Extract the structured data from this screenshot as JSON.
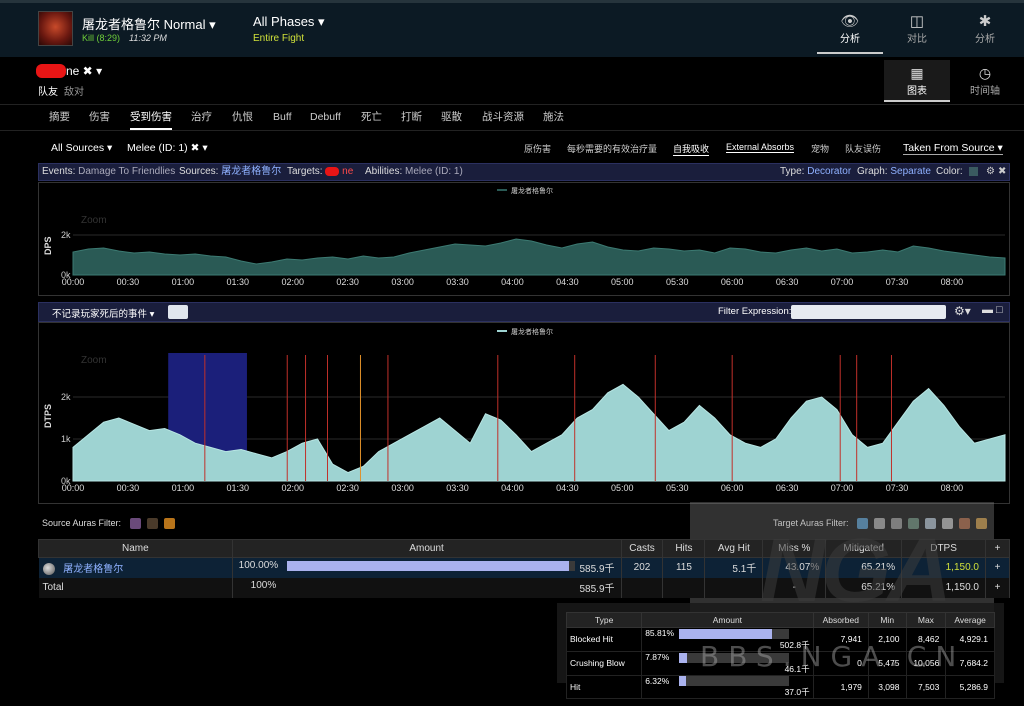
{
  "header": {
    "encounter_title": "屠龙者格鲁尔 Normal ▾",
    "kill_text": "Kill (8:29)",
    "time_text": "11:32 PM",
    "phase_title": "All Phases ▾",
    "phase_sub": "Entire Fight",
    "nav": [
      {
        "label": "分析",
        "icon": "eye-icon"
      },
      {
        "label": "对比",
        "icon": "compare-icon"
      },
      {
        "label": "分析",
        "icon": "puzzle-icon"
      }
    ]
  },
  "player": {
    "name_suffix": "ne ✖ ▾",
    "ally": "队友",
    "enemy": "敌对",
    "views": [
      {
        "label": "图表",
        "icon": "grid-icon"
      },
      {
        "label": "时间轴",
        "icon": "clock-icon"
      }
    ]
  },
  "tabs": [
    "摘要",
    "伤害",
    "受到伤害",
    "治疗",
    "仇恨",
    "Buff",
    "Debuff",
    "死亡",
    "打断",
    "驱散",
    "战斗资源",
    "施法"
  ],
  "filters": {
    "sources": "All Sources ▾",
    "ability": "Melee (ID: 1) ✖ ▾",
    "right_options": [
      "原伤害",
      "每秒需要的有效治疗量",
      "自我吸收",
      "External Absorbs",
      "宠物",
      "队友误伤"
    ],
    "taken": "Taken From Source ▾"
  },
  "events_bar": {
    "events_k": "Events:",
    "events_v": "Damage To Friendlies",
    "sources_k": "Sources:",
    "sources_v": "屠龙者格鲁尔",
    "targets_k": "Targets:",
    "targets_v": "ne",
    "abilities_k": "Abilities:",
    "abilities_v": "Melee (ID: 1)",
    "type_k": "Type:",
    "type_v": "Decorator",
    "graph_k": "Graph:",
    "graph_v": "Separate",
    "color_k": "Color:"
  },
  "chart_data": [
    {
      "type": "area",
      "legend": "屠龙者格鲁尔",
      "ylabel": "DPS",
      "zoom_label": "Zoom",
      "yticks": [
        "2k",
        "0k"
      ],
      "ylim": [
        0,
        3000
      ],
      "xticks": [
        "00:00",
        "00:30",
        "01:00",
        "01:30",
        "02:00",
        "02:30",
        "03:00",
        "03:30",
        "04:00",
        "04:30",
        "05:00",
        "05:30",
        "06:00",
        "06:30",
        "07:00",
        "07:30",
        "08:00"
      ],
      "x_seconds_range": [
        0,
        509
      ],
      "values": [
        1150,
        1300,
        1350,
        1200,
        1100,
        1150,
        1050,
        1000,
        1050,
        950,
        900,
        700,
        550,
        650,
        800,
        750,
        850,
        900,
        800,
        950,
        850,
        900,
        1100,
        1250,
        1400,
        1550,
        1500,
        1450,
        1600,
        1800,
        1700,
        1500,
        1350,
        1550,
        1650,
        1400,
        1250,
        1200,
        1350,
        1300,
        1200,
        1250,
        1100,
        1350,
        1300,
        1150,
        1100,
        1250,
        1350,
        1200,
        1300,
        1100,
        1150,
        1250,
        1150,
        1450,
        1350,
        1200,
        1100,
        1000,
        900,
        850
      ]
    },
    {
      "type": "area",
      "legend": "屠龙者格鲁尔",
      "ylabel": "DTPS",
      "zoom_label": "Zoom",
      "yticks": [
        "2k",
        "1k",
        "0k"
      ],
      "ylim": [
        0,
        3000
      ],
      "xticks": [
        "00:00",
        "00:30",
        "01:00",
        "01:30",
        "02:00",
        "02:30",
        "03:00",
        "03:30",
        "04:00",
        "04:30",
        "05:00",
        "05:30",
        "06:00",
        "06:30",
        "07:00",
        "07:30",
        "08:00"
      ],
      "x_seconds_range": [
        0,
        509
      ],
      "values": [
        800,
        1100,
        1400,
        1500,
        1350,
        1200,
        1250,
        1100,
        900,
        800,
        700,
        750,
        650,
        550,
        700,
        900,
        1000,
        400,
        200,
        350,
        700,
        900,
        1100,
        1300,
        1500,
        1200,
        900,
        1600,
        1450,
        1100,
        700,
        900,
        1100,
        1500,
        1700,
        2100,
        2300,
        2000,
        1600,
        1200,
        1400,
        1800,
        1500,
        1100,
        900,
        800,
        1000,
        1500,
        1900,
        2000,
        1700,
        1100,
        800,
        900,
        1400,
        1900,
        2200,
        1800,
        1300,
        900,
        1000,
        1100
      ],
      "death_markers_sec": [
        72,
        117,
        127,
        139,
        172,
        232,
        274,
        318,
        360,
        419,
        428,
        447
      ],
      "highlight_range_sec": [
        52,
        95
      ],
      "orange_marker_sec": [
        157
      ]
    }
  ],
  "bar2": {
    "label": "不记录玩家死后的事件 ▾",
    "filter_label": "Filter Expression:"
  },
  "auras": {
    "source_label": "Source Auras Filter:",
    "target_label": "Target Auras Filter:"
  },
  "main_table": {
    "headers": [
      "Name",
      "Amount",
      "Casts",
      "Hits",
      "Avg Hit",
      "Miss %",
      "Mitigated",
      "DTPS",
      "+"
    ],
    "rows": [
      {
        "name": "屠龙者格鲁尔",
        "pct": "100.00%",
        "pct_value": 100,
        "amount": "585.9千",
        "casts": "202",
        "hits": "115",
        "avg": "5.1千",
        "miss": "43.07%",
        "mitigated": "65.21%",
        "dtps": "1,150.0",
        "plus": "+"
      },
      {
        "name": "Total",
        "pct": "100%",
        "amount": "585.9千",
        "casts": "",
        "hits": "",
        "avg": "",
        "miss": "-",
        "mitigated": "65.21%",
        "dtps": "1,150.0",
        "plus": "+"
      }
    ]
  },
  "sub_table": {
    "headers": [
      "Type",
      "Amount",
      "Absorbed",
      "Min",
      "Max",
      "Average"
    ],
    "rows": [
      {
        "type": "Blocked Hit",
        "pct": "85.81%",
        "pct_value": 85.81,
        "amount": "502.8千",
        "absorbed": "7,941",
        "min": "2,100",
        "max": "8,462",
        "avg": "4,929.1"
      },
      {
        "type": "Crushing Blow",
        "pct": "7.87%",
        "pct_value": 7.87,
        "amount": "46.1千",
        "absorbed": "0",
        "min": "5,475",
        "max": "10,056",
        "avg": "7,684.2"
      },
      {
        "type": "Hit",
        "pct": "6.32%",
        "pct_value": 6.32,
        "amount": "37.0千",
        "absorbed": "1,979",
        "min": "3,098",
        "max": "7,503",
        "avg": "5,286.9"
      }
    ]
  },
  "watermark": {
    "logo": "NGA",
    "url": "BBS.NGA.CN"
  },
  "colors": {
    "area": "#9ed3d2",
    "area_dark": "#2a5a55",
    "death_line": "#c0302a",
    "highlight": "#1b1f7a",
    "accent_green": "#6fcf3a"
  }
}
